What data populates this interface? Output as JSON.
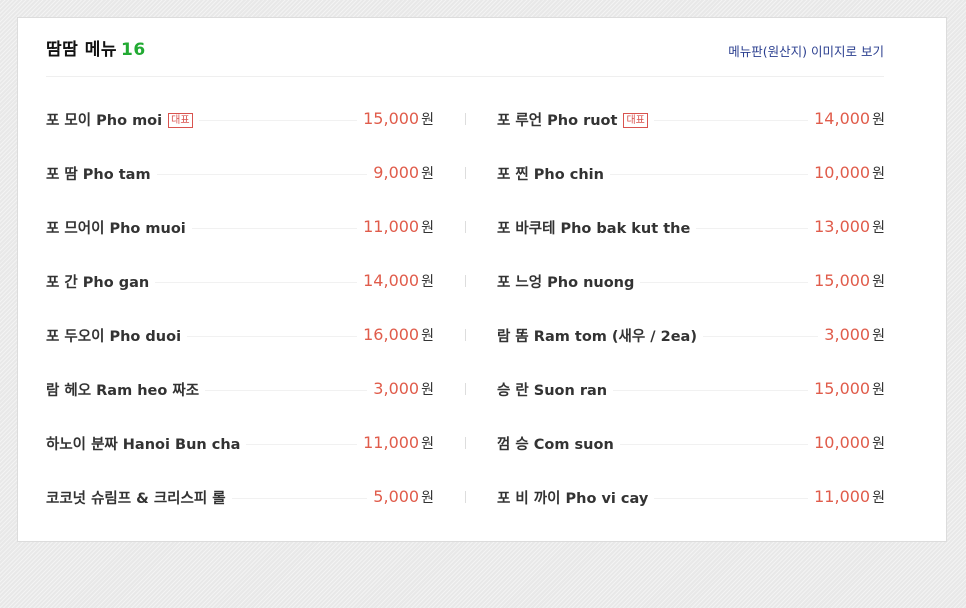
{
  "header": {
    "title": "땀땀 메뉴",
    "count": "16",
    "view_link": "메뉴판(원산지) 이미지로 보기"
  },
  "badge_label": "대표",
  "currency_unit": "원",
  "colors": {
    "count": "#22aa33",
    "price": "#e05c4b",
    "badge": "#d9534f",
    "link": "#2a3e8f"
  },
  "menu": {
    "left": [
      {
        "name": "포 모이 Pho moi",
        "badge": true,
        "price": "15,000"
      },
      {
        "name": "포 땀 Pho tam",
        "badge": false,
        "price": "9,000"
      },
      {
        "name": "포 므어이 Pho muoi",
        "badge": false,
        "price": "11,000"
      },
      {
        "name": "포 간 Pho gan",
        "badge": false,
        "price": "14,000"
      },
      {
        "name": "포 두오이 Pho duoi",
        "badge": false,
        "price": "16,000"
      },
      {
        "name": "람 헤오 Ram heo 짜조",
        "badge": false,
        "price": "3,000"
      },
      {
        "name": "하노이 분짜 Hanoi Bun cha",
        "badge": false,
        "price": "11,000"
      },
      {
        "name": "코코넛 슈림프 & 크리스피 롤",
        "badge": false,
        "price": "5,000"
      }
    ],
    "right": [
      {
        "name": "포 루언 Pho ruot",
        "badge": true,
        "price": "14,000"
      },
      {
        "name": "포 찐 Pho chin",
        "badge": false,
        "price": "10,000"
      },
      {
        "name": "포 바쿠테 Pho bak kut the",
        "badge": false,
        "price": "13,000"
      },
      {
        "name": "포 느엉 Pho nuong",
        "badge": false,
        "price": "15,000"
      },
      {
        "name": "람 똠 Ram tom (새우 / 2ea)",
        "badge": false,
        "price": "3,000"
      },
      {
        "name": "승 란 Suon ran",
        "badge": false,
        "price": "15,000"
      },
      {
        "name": "껌 승 Com suon",
        "badge": false,
        "price": "10,000"
      },
      {
        "name": "포 비 까이 Pho vi cay",
        "badge": false,
        "price": "11,000"
      }
    ]
  }
}
